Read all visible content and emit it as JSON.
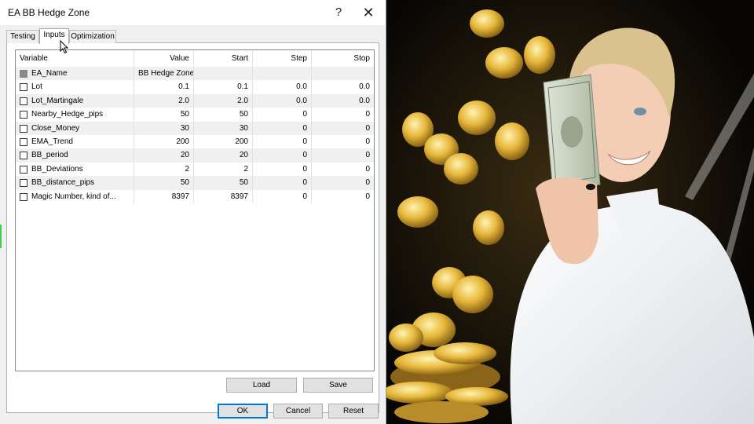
{
  "window": {
    "title": "EA BB Hedge Zone",
    "help": "?",
    "close": "✕"
  },
  "tabs": [
    {
      "label": "Testing",
      "active": false
    },
    {
      "label": "Inputs",
      "active": true
    },
    {
      "label": "Optimization",
      "active": false
    }
  ],
  "grid": {
    "columns": [
      "Variable",
      "Value",
      "Start",
      "Step",
      "Stop"
    ],
    "rows": [
      {
        "name": "EA_Name",
        "value": "BB Hedge Zone",
        "start": "",
        "step": "",
        "stop": "",
        "disabled": true
      },
      {
        "name": "Lot",
        "value": "0.1",
        "start": "0.1",
        "step": "0.0",
        "stop": "0.0"
      },
      {
        "name": "Lot_Martingale",
        "value": "2.0",
        "start": "2.0",
        "step": "0.0",
        "stop": "0.0"
      },
      {
        "name": "Nearby_Hedge_pips",
        "value": "50",
        "start": "50",
        "step": "0",
        "stop": "0"
      },
      {
        "name": "Close_Money",
        "value": "30",
        "start": "30",
        "step": "0",
        "stop": "0"
      },
      {
        "name": "EMA_Trend",
        "value": "200",
        "start": "200",
        "step": "0",
        "stop": "0"
      },
      {
        "name": "BB_period",
        "value": "20",
        "start": "20",
        "step": "0",
        "stop": "0"
      },
      {
        "name": "BB_Deviations",
        "value": "2",
        "start": "2",
        "step": "0",
        "stop": "0"
      },
      {
        "name": "BB_distance_pips",
        "value": "50",
        "start": "50",
        "step": "0",
        "stop": "0"
      },
      {
        "name": "Magic Number, kind of...",
        "value": "8397",
        "start": "8397",
        "step": "0",
        "stop": "0"
      }
    ]
  },
  "buttons": {
    "load": "Load",
    "save": "Save",
    "ok": "OK",
    "cancel": "Cancel",
    "reset": "Reset"
  },
  "colors": {
    "accent": "#0078d7",
    "gold": "#e8b83a",
    "background": "#0c0a06"
  }
}
